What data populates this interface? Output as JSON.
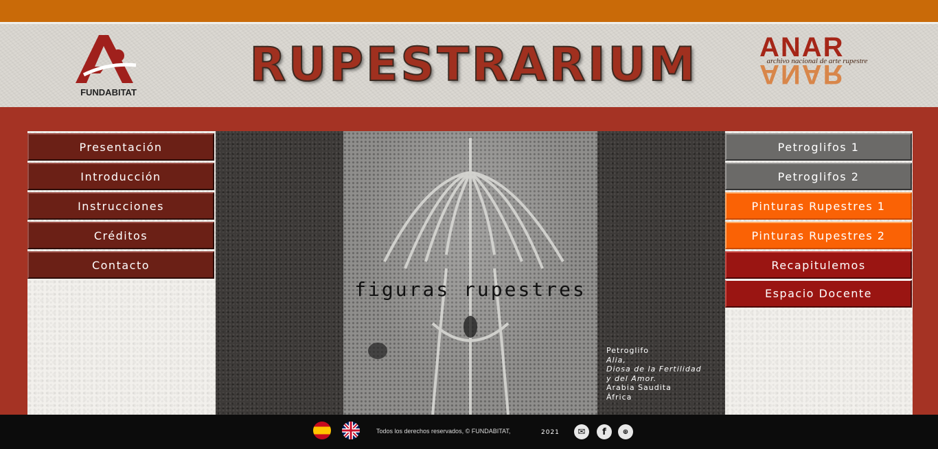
{
  "header": {
    "left_logo_text": "FUNDABITAT",
    "title": "RUPESTRARIUM",
    "right_logo_top": "ANAR",
    "right_logo_sub": "archivo nacional de arte rupestre"
  },
  "nav_left": [
    {
      "label": "Presentación"
    },
    {
      "label": "Introducción"
    },
    {
      "label": "Instrucciones"
    },
    {
      "label": "Créditos"
    },
    {
      "label": "Contacto"
    }
  ],
  "nav_right": [
    {
      "label": "Petroglifos  1"
    },
    {
      "label": "Petroglifos  2"
    },
    {
      "label": "Pinturas Rupestres  1"
    },
    {
      "label": "Pinturas Rupestres  2"
    },
    {
      "label": "Recapitulemos"
    },
    {
      "label": "Espacio Docente"
    }
  ],
  "main": {
    "photo_title": "figuras rupestres",
    "caption": {
      "line1": "Petroglifo",
      "line2": "Alia,",
      "line3": "Diosa de la Fertilidad",
      "line4": "y del Amor.",
      "line5": "Arabia Saudita",
      "line6": "África"
    }
  },
  "footer": {
    "copyright": "Todos los derechos reservados,  © FUNDABITAT,",
    "year": "2021",
    "icons": [
      "mail-icon",
      "facebook-icon",
      "www-icon"
    ]
  },
  "colors": {
    "topbar": "#c96a08",
    "main_bg": "#a53324",
    "btn_dark_red": "#6b2016",
    "btn_grey": "#6b6a68",
    "btn_orange": "#fa6205",
    "btn_red": "#9a1512"
  }
}
